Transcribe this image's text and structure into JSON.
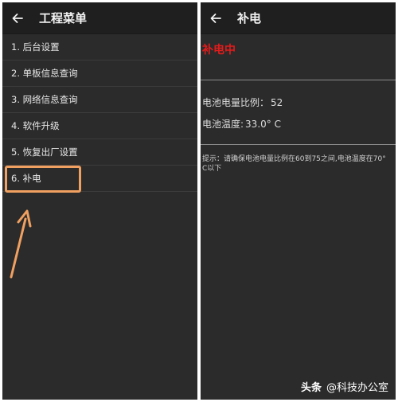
{
  "left": {
    "title": "工程菜单",
    "menu": [
      {
        "label": "1. 后台设置"
      },
      {
        "label": "2. 单板信息查询"
      },
      {
        "label": "3. 网络信息查询"
      },
      {
        "label": "4. 软件升级"
      },
      {
        "label": "5. 恢复出厂设置"
      },
      {
        "label": "6. 补电"
      }
    ]
  },
  "right": {
    "title": "补电",
    "status": "补电中",
    "battery_ratio_label": "电池电量比例：",
    "battery_ratio_value": "52",
    "battery_temp_label": "电池温度:",
    "battery_temp_value": "33.0° C",
    "tip": "提示：请确保电池电量比例在60到75之间,电池温度在70° C以下"
  },
  "watermark": {
    "brand": "头条",
    "handle": "@科技办公室"
  },
  "colors": {
    "panel_bg": "#2b2b2b",
    "appbar_bg": "#1f1f1f",
    "status_red": "#e21b1b",
    "highlight_orange": "#f0a060"
  }
}
